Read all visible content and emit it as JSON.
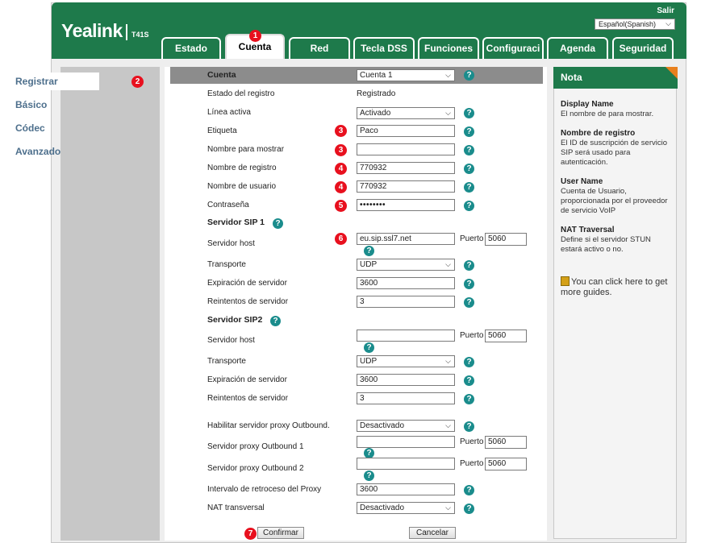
{
  "header": {
    "logo": "Yealink",
    "model": "T41S",
    "logout": "Salir",
    "language": "Español(Spanish)"
  },
  "tabs": [
    {
      "label": "Estado"
    },
    {
      "label": "Cuenta",
      "active": true
    },
    {
      "label": "Red"
    },
    {
      "label": "Tecla DSS"
    },
    {
      "label": "Funciones"
    },
    {
      "label": "Configuraci"
    },
    {
      "label": "Agenda"
    },
    {
      "label": "Seguridad"
    }
  ],
  "sidebar": {
    "items": [
      {
        "label": "Registrar",
        "active": true
      },
      {
        "label": "Básico"
      },
      {
        "label": "Códec"
      },
      {
        "label": "Avanzado"
      }
    ]
  },
  "badges": [
    "1",
    "2",
    "3",
    "3",
    "4",
    "4",
    "5",
    "6",
    "7"
  ],
  "form": {
    "cuenta_label": "Cuenta",
    "cuenta_value": "Cuenta 1",
    "estado_label": "Estado del registro",
    "estado_value": "Registrado",
    "linea_label": "Línea activa",
    "linea_value": "Activado",
    "etiqueta_label": "Etiqueta",
    "etiqueta_value": "Paco",
    "nombre_mostrar_label": "Nombre para mostrar",
    "nombre_mostrar_value": "",
    "nombre_registro_label": "Nombre de registro",
    "nombre_registro_value": "770932",
    "nombre_usuario_label": "Nombre de usuario",
    "nombre_usuario_value": "770932",
    "contrasena_label": "Contraseña",
    "contrasena_value": "••••••••",
    "sip1": {
      "heading": "Servidor SIP 1",
      "host_label": "Servidor host",
      "host_value": "eu.sip.ssl7.net",
      "port_label": "Puerto",
      "port_value": "5060",
      "transporte_label": "Transporte",
      "transporte_value": "UDP",
      "expiracion_label": "Expiración de servidor",
      "expiracion_value": "3600",
      "reintentos_label": "Reintentos de servidor",
      "reintentos_value": "3"
    },
    "sip2": {
      "heading": "Servidor SIP2",
      "host_label": "Servidor host",
      "host_value": "",
      "port_label": "Puerto",
      "port_value": "5060",
      "transporte_label": "Transporte",
      "transporte_value": "UDP",
      "expiracion_label": "Expiración de servidor",
      "expiracion_value": "3600",
      "reintentos_label": "Reintentos de servidor",
      "reintentos_value": "3"
    },
    "proxy_enable_label": "Habilitar servidor proxy Outbound.",
    "proxy_enable_value": "Desactivado",
    "proxy1_label": "Servidor proxy Outbound 1",
    "proxy1_value": "",
    "proxy1_port_label": "Puerto",
    "proxy1_port_value": "5060",
    "proxy2_label": "Servidor proxy Outbound 2",
    "proxy2_value": "",
    "proxy2_port_label": "Puerto",
    "proxy2_port_value": "5060",
    "retroceso_label": "Intervalo de retroceso del Proxy",
    "retroceso_value": "3600",
    "nat_label": "NAT transversal",
    "nat_value": "Desactivado",
    "confirm_label": "Confirmar",
    "cancel_label": "Cancelar"
  },
  "nota": {
    "title": "Nota",
    "items": [
      {
        "title": "Display Name",
        "text": "El nombre de para mostrar."
      },
      {
        "title": "Nombre de registro",
        "text": "El ID de suscripción de servicio SIP será usado para autenticación."
      },
      {
        "title": "User Name",
        "text": "Cuenta de Usuario, proporcionada por el proveedor de servicio VoIP"
      },
      {
        "title": "NAT Traversal",
        "text": "Define si el servidor STUN estará activo o no."
      }
    ],
    "guide_text": "You can click here to get more guides."
  },
  "help_glyph": "?",
  "chevron_glyph": "⌵"
}
